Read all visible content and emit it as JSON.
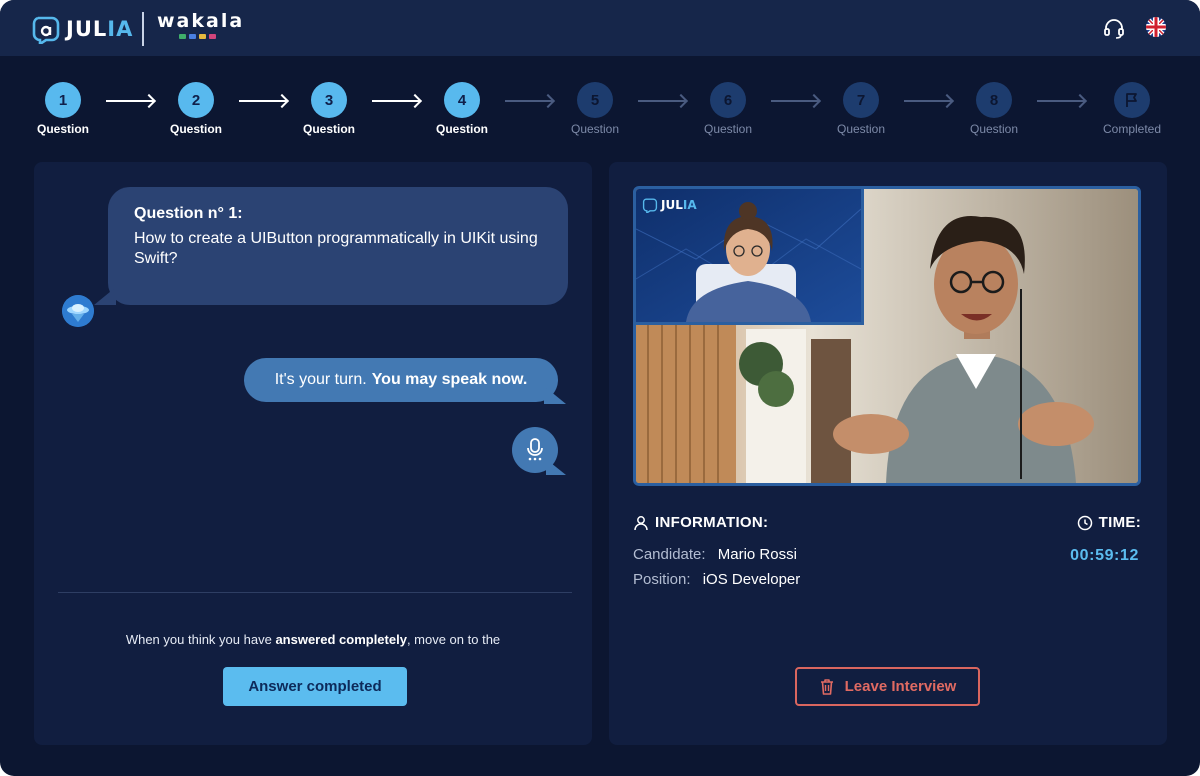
{
  "brand": {
    "julia_main": "JUL",
    "julia_accent": "IA",
    "partner": "wakala",
    "partner_dot_colors": [
      "#3fae6b",
      "#4a7fe0",
      "#e6b93f",
      "#d2457c"
    ]
  },
  "header": {
    "support_icon": "headset-icon",
    "language_icon": "uk-flag-icon"
  },
  "stepper": {
    "steps": [
      {
        "label": "Question",
        "number": "1",
        "state": "active"
      },
      {
        "label": "Question",
        "number": "2",
        "state": "active"
      },
      {
        "label": "Question",
        "number": "3",
        "state": "active"
      },
      {
        "label": "Question",
        "number": "4",
        "state": "active"
      },
      {
        "label": "Question",
        "number": "5",
        "state": "inactive"
      },
      {
        "label": "Question",
        "number": "6",
        "state": "inactive"
      },
      {
        "label": "Question",
        "number": "7",
        "state": "inactive"
      },
      {
        "label": "Question",
        "number": "8",
        "state": "inactive"
      },
      {
        "label": "Completed",
        "icon": "flag-icon",
        "state": "inactive"
      }
    ]
  },
  "chat": {
    "question_title": "Question n° 1:",
    "question_text": "How to create a UIButton programmatically in UIKit using Swift?",
    "turn_prefix": "It's your turn.",
    "turn_bold": "You may speak now.",
    "mic_icon": "microphone-icon"
  },
  "footer_left": {
    "hint_prefix": "When you think you have",
    "hint_bold": "answered completely",
    "hint_suffix": ", move on to the",
    "answer_button": "Answer completed"
  },
  "video": {
    "watermark_main": "JUL",
    "watermark_accent": "IA"
  },
  "information": {
    "title": "INFORMATION:",
    "candidate_label": "Candidate:",
    "candidate_value": "Mario Rossi",
    "position_label": "Position:",
    "position_value": "iOS Developer"
  },
  "time": {
    "title": "TIME:",
    "value": "00:59:12"
  },
  "leave_button": "Leave Interview",
  "colors": {
    "background": "#0c1631",
    "topbar": "#16264a",
    "panel": "#111e40",
    "accent": "#58b9ee",
    "danger": "#d9665f"
  }
}
